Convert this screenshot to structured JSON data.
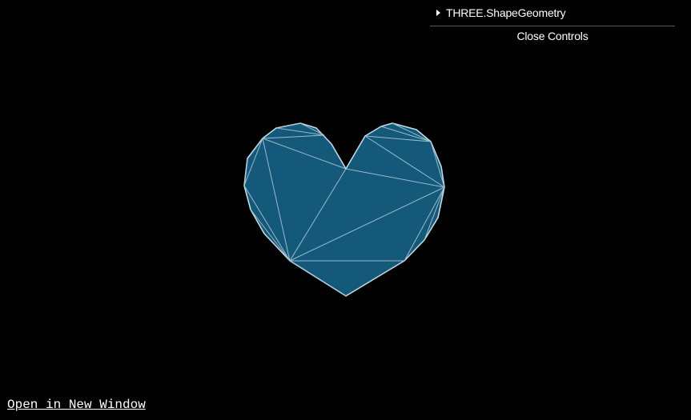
{
  "gui": {
    "folder_title": "THREE.ShapeGeometry",
    "close_label": "Close Controls"
  },
  "link": {
    "label": "Open in New Window"
  },
  "colors": {
    "background": "#000000",
    "fill": "#14587a",
    "wireframe": "#b9d3dd"
  },
  "icons": {
    "folder_toggle": "triangle-right-icon"
  }
}
